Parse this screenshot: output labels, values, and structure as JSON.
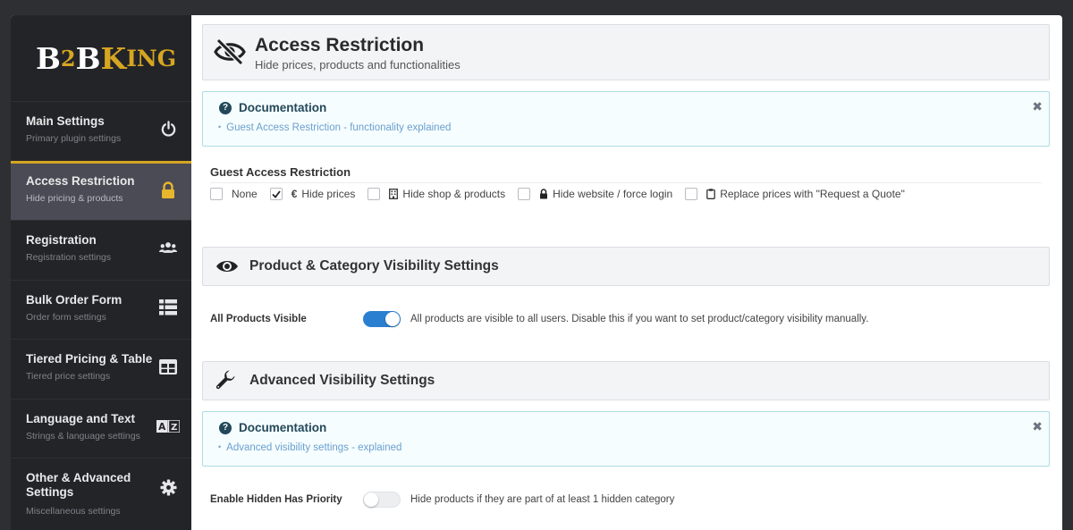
{
  "brand": {
    "b": "B",
    "two": "2",
    "b2": "B",
    "k": "K",
    "ing": "ING"
  },
  "sidebar": {
    "items": [
      {
        "title": "Main Settings",
        "sub": "Primary plugin settings",
        "icon": "power-icon"
      },
      {
        "title": "Access Restriction",
        "sub": "Hide pricing & products",
        "icon": "lock-icon"
      },
      {
        "title": "Registration",
        "sub": "Registration settings",
        "icon": "users-icon"
      },
      {
        "title": "Bulk Order Form",
        "sub": "Order form settings",
        "icon": "list-icon"
      },
      {
        "title": "Tiered Pricing & Table",
        "sub": "Tiered price settings",
        "icon": "table-icon"
      },
      {
        "title": "Language and Text",
        "sub": "Strings & language settings",
        "icon": "translate-icon"
      },
      {
        "title": "Other & Advanced Settings",
        "sub": "Miscellaneous settings",
        "icon": "gear-icon"
      }
    ]
  },
  "header": {
    "title": "Access Restriction",
    "subtitle": "Hide prices, products and functionalities"
  },
  "doc1": {
    "title": "Documentation",
    "link": "Guest Access Restriction - functionality explained"
  },
  "guest": {
    "label": "Guest Access Restriction",
    "options": [
      {
        "label": "None",
        "checked": false
      },
      {
        "label": "Hide prices",
        "checked": true,
        "icon": "euro-icon"
      },
      {
        "label": "Hide shop & products",
        "checked": false,
        "icon": "building-icon"
      },
      {
        "label": "Hide website / force login",
        "checked": false,
        "icon": "lock-icon"
      },
      {
        "label": "Replace prices with \"Request a Quote\"",
        "checked": false,
        "icon": "clipboard-icon"
      }
    ]
  },
  "visibility": {
    "title": "Product & Category Visibility Settings",
    "row_label": "All Products Visible",
    "row_desc": "All products are visible to all users. Disable this if you want to set product/category visibility manually.",
    "toggle_on": true
  },
  "advanced": {
    "title": "Advanced Visibility Settings",
    "doc_title": "Documentation",
    "doc_link": "Advanced visibility settings - explained",
    "row_label": "Enable Hidden Has Priority",
    "row_desc": "Hide products if they are part of at least 1 hidden category",
    "toggle_on": false
  },
  "colors": {
    "accent": "#d6a521",
    "toggle_on": "#2b7fd0",
    "sidebar": "#232428",
    "link": "#6a9fcf"
  }
}
